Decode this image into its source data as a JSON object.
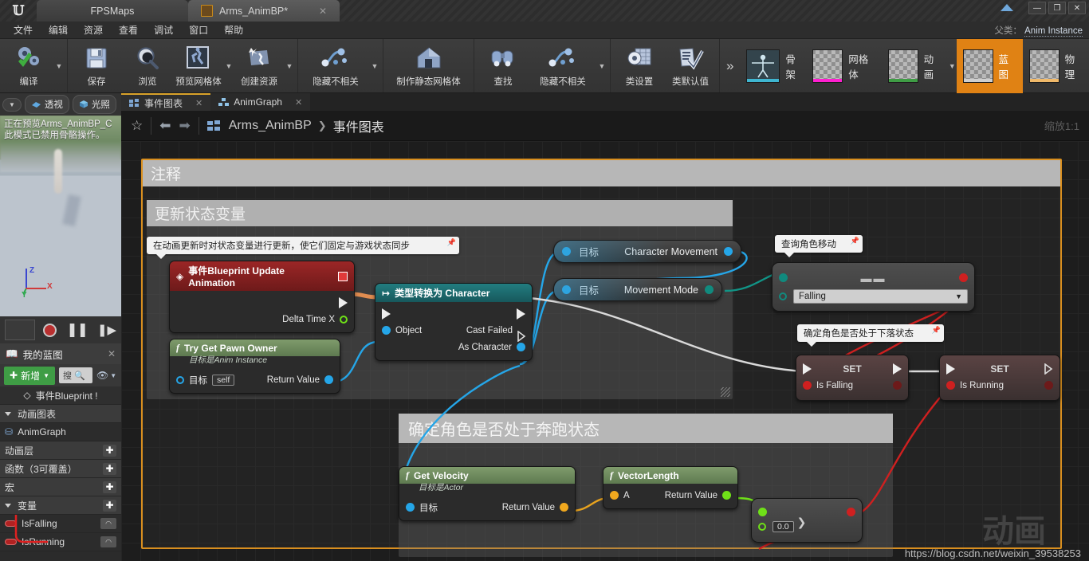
{
  "window": {
    "tabs": [
      {
        "label": "FPSMaps",
        "active": false,
        "icon": null
      },
      {
        "label": "Arms_AnimBP*",
        "active": true,
        "icon": "blueprint-icon"
      }
    ],
    "controls": {
      "minimize": "—",
      "maximize": "❐",
      "close": "✕"
    }
  },
  "menu": {
    "items": [
      "文件",
      "编辑",
      "资源",
      "查看",
      "调试",
      "窗口",
      "帮助"
    ]
  },
  "parent_class": {
    "label": "父类：",
    "value": "Anim Instance"
  },
  "toolbar": {
    "groups": [
      {
        "buttons": [
          {
            "label": "编译",
            "icon": "compile-icon",
            "caret": true
          }
        ]
      },
      {
        "buttons": [
          {
            "label": "保存",
            "icon": "save-icon",
            "caret": false
          },
          {
            "label": "浏览",
            "icon": "browse-icon",
            "caret": false
          },
          {
            "label": "预览网格体",
            "icon": "preview-mesh-icon",
            "caret": true
          },
          {
            "label": "创建资源",
            "icon": "create-asset-icon",
            "caret": true
          }
        ]
      },
      {
        "buttons": [
          {
            "label": "隐藏不相关",
            "icon": "hide-unrelated-icon",
            "caret": true
          }
        ]
      },
      {
        "buttons": [
          {
            "label": "制作静态网格体",
            "icon": "make-static-mesh-icon",
            "caret": false
          }
        ]
      },
      {
        "buttons": [
          {
            "label": "查找",
            "icon": "find-icon",
            "caret": false
          },
          {
            "label": "隐藏不相关",
            "icon": "hide-unrelated-icon",
            "caret": true
          }
        ]
      },
      {
        "buttons": [
          {
            "label": "类设置",
            "icon": "class-settings-icon",
            "caret": false
          },
          {
            "label": "类默认值",
            "icon": "class-defaults-icon",
            "caret": false
          }
        ]
      }
    ],
    "overflow": "»",
    "modes": [
      {
        "label": "骨架",
        "selected": false,
        "accent": "#3fb6d1"
      },
      {
        "label": "网格体",
        "selected": false,
        "accent": "#ff1fd0"
      },
      {
        "label": "动画",
        "selected": false,
        "accent": "#3f9d45",
        "caret": true
      },
      {
        "label": "蓝图",
        "selected": true,
        "accent": "#c9c9c9"
      },
      {
        "label": "物理",
        "selected": false,
        "accent": "#f0b96a"
      }
    ]
  },
  "viewport": {
    "perspective_label": "透视",
    "lighting_label": "光照",
    "overlay_line1": "正在预览Arms_AnimBP_C",
    "overlay_line2": "此模式已禁用骨骼操作。",
    "axes": {
      "x": "X",
      "y": "Y",
      "z": "Z"
    }
  },
  "my_blueprint": {
    "title": "我的蓝图",
    "add_label": "新增",
    "search_label": "搜",
    "rows": [
      {
        "label": "事件Blueprint !",
        "type": "event",
        "centered": true
      },
      {
        "label": "动画图表",
        "type": "section"
      },
      {
        "label": "AnimGraph",
        "type": "item"
      },
      {
        "label": "动画层",
        "type": "section-plus"
      },
      {
        "label": "函数（3可覆盖）",
        "type": "section-plus"
      },
      {
        "label": "宏",
        "type": "section-plus"
      },
      {
        "label": "变量",
        "type": "section-plus"
      },
      {
        "label": "IsFalling",
        "type": "variable"
      },
      {
        "label": "IsRunning",
        "type": "variable"
      }
    ]
  },
  "graph": {
    "tabs": [
      {
        "label": "事件图表",
        "active": true,
        "icon": "graph-icon"
      },
      {
        "label": "AnimGraph",
        "active": false,
        "icon": "animgraph-icon"
      }
    ],
    "breadcrumb": {
      "root": "Arms_AnimBP",
      "separator": "❯",
      "current": "事件图表"
    },
    "zoom_label": "缩放1:1",
    "comments": [
      {
        "title": "注释"
      },
      {
        "title": "更新状态变量"
      },
      {
        "title": "确定角色是否处于奔跑状态"
      }
    ],
    "tooltips": [
      {
        "text": "在动画更新时对状态变量进行更新，使它们固定与游戏状态同步"
      },
      {
        "text": "查询角色移动"
      },
      {
        "text": "确定角色是否处于下落状态"
      }
    ],
    "nodes": {
      "event_update": {
        "title": "事件Blueprint Update Animation",
        "out_pin": "Delta Time X"
      },
      "try_get_pawn": {
        "title": "Try Get Pawn Owner",
        "subtitle": "目标是Anim Instance",
        "target": "目标",
        "self": "self",
        "return": "Return Value"
      },
      "cast_character": {
        "title": "类型转换为 Character",
        "object": "Object",
        "cast_failed": "Cast Failed",
        "as_character": "As Character"
      },
      "character_movement": {
        "target": "目标",
        "value": "Character Movement"
      },
      "movement_mode": {
        "target": "目标",
        "value": "Movement Mode"
      },
      "enum_equal": {
        "dropdown_value": "Falling"
      },
      "set_is_falling": {
        "title": "SET",
        "pin": "Is Falling"
      },
      "set_is_running": {
        "title": "SET",
        "pin": "Is Running"
      },
      "get_velocity": {
        "title": "Get Velocity",
        "subtitle": "目标是Actor",
        "target": "目标",
        "return": "Return Value"
      },
      "vector_length": {
        "title": "VectorLength",
        "input_a": "A",
        "return": "Return Value"
      },
      "greater_than": {
        "symbol": "❯",
        "value": "0.0"
      }
    },
    "watermark": "动画",
    "url": "https://blog.csdn.net/weixin_39538253"
  },
  "colors": {
    "accent_orange": "#d98f1f",
    "exec_white": "#eeeeee",
    "object_blue": "#2da3e8",
    "bool_red": "#b02020",
    "float_green": "#6fe018",
    "vector_gold": "#f0a81e",
    "enum_teal": "#118a7e",
    "event_red": "#8f1f1f",
    "cast_teal": "#1d6f72",
    "func_green": "#5c7a4a"
  }
}
